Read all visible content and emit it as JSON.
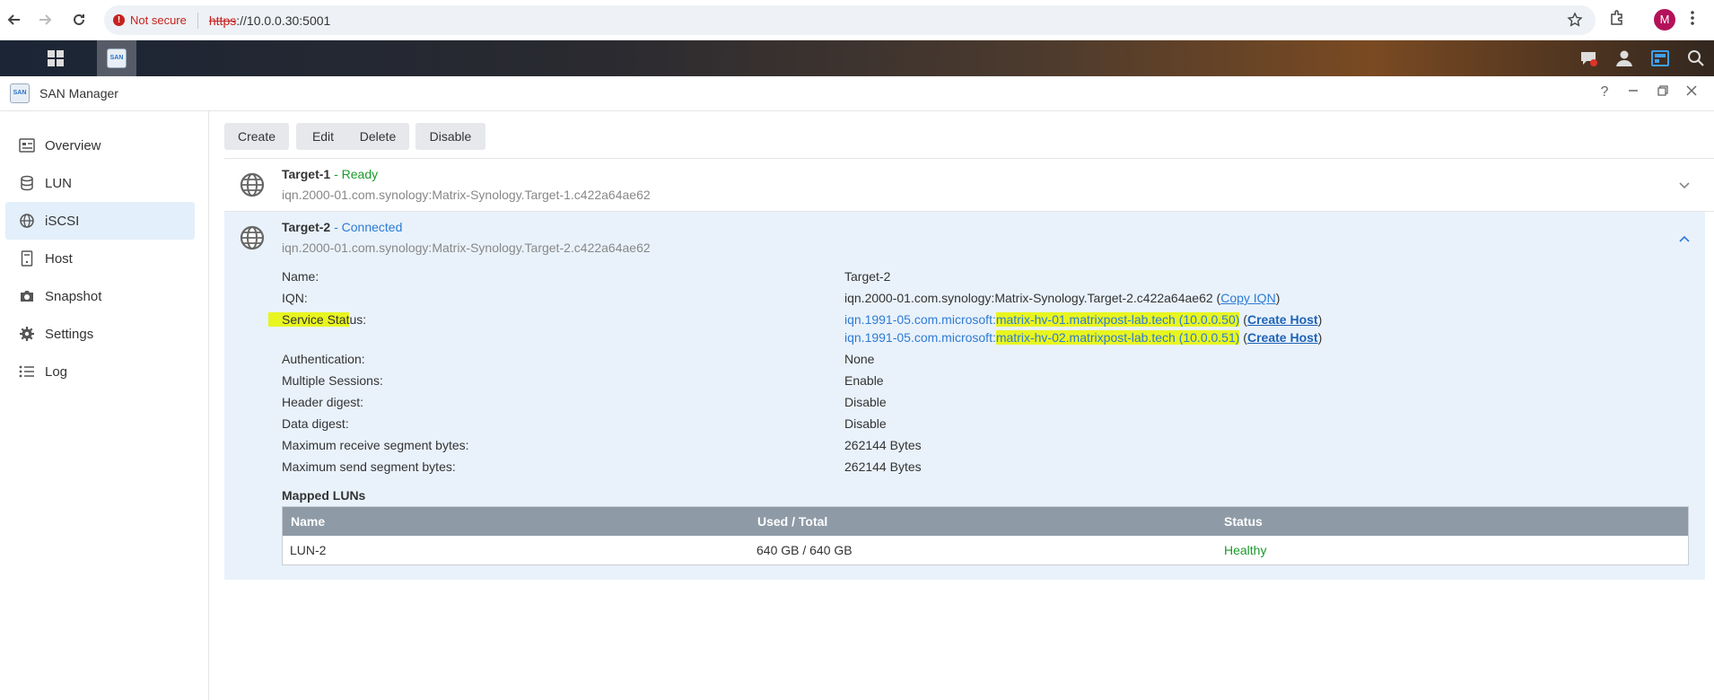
{
  "browser": {
    "security_label": "Not secure",
    "url_scheme": "https",
    "url_rest": "://10.0.0.30:5001",
    "profile_initial": "M"
  },
  "window": {
    "title": "SAN Manager"
  },
  "sidebar": {
    "items": [
      {
        "label": "Overview",
        "icon": "overview-icon"
      },
      {
        "label": "LUN",
        "icon": "database-icon"
      },
      {
        "label": "iSCSI",
        "icon": "globe-icon"
      },
      {
        "label": "Host",
        "icon": "host-icon"
      },
      {
        "label": "Snapshot",
        "icon": "camera-icon"
      },
      {
        "label": "Settings",
        "icon": "gear-icon"
      },
      {
        "label": "Log",
        "icon": "list-icon"
      }
    ],
    "active": "iSCSI"
  },
  "toolbar": {
    "create": "Create",
    "edit": "Edit",
    "delete": "Delete",
    "disable": "Disable"
  },
  "targets": [
    {
      "name": "Target-1",
      "separator": " - ",
      "status": "Ready",
      "iqn": "iqn.2000-01.com.synology:Matrix-Synology.Target-1.c422a64ae62",
      "expanded": false
    },
    {
      "name": "Target-2",
      "separator": " - ",
      "status": "Connected",
      "iqn": "iqn.2000-01.com.synology:Matrix-Synology.Target-2.c422a64ae62",
      "expanded": true
    }
  ],
  "details": {
    "name_label": "Name:",
    "name_value": "Target-2",
    "iqn_label": "IQN:",
    "iqn_value": "iqn.2000-01.com.synology:Matrix-Synology.Target-2.c422a64ae62",
    "copy_iqn": "Copy IQN",
    "service_status_label_hl": "Service Stat",
    "service_status_label_rest": "us:",
    "sessions": [
      {
        "prefix": "iqn.1991-05.com.microsoft:",
        "host": "matrix-hv-01.matrixpost-lab.tech (10.0.0.50)",
        "action": "Create Host"
      },
      {
        "prefix": "iqn.1991-05.com.microsoft:",
        "host": "matrix-hv-02.matrixpost-lab.tech (10.0.0.51)",
        "action": "Create Host"
      }
    ],
    "authentication_label": "Authentication:",
    "authentication_value": "None",
    "multi_sessions_label": "Multiple Sessions:",
    "multi_sessions_value": "Enable",
    "header_digest_label": "Header digest:",
    "header_digest_value": "Disable",
    "data_digest_label": "Data digest:",
    "data_digest_value": "Disable",
    "max_recv_label": "Maximum receive segment bytes:",
    "max_recv_value": "262144 Bytes",
    "max_send_label": "Maximum send segment bytes:",
    "max_send_value": "262144 Bytes",
    "mapped_luns_title": "Mapped LUNs"
  },
  "lun_table": {
    "headers": [
      "Name",
      "Used / Total",
      "Status"
    ],
    "rows": [
      {
        "name": "LUN-2",
        "used_total": "640 GB / 640 GB",
        "status": "Healthy"
      }
    ]
  },
  "colors": {
    "ready": "#1a9a29",
    "connected": "#2d7bd4",
    "highlight": "#e8f51f",
    "active_nav": "#e3effa"
  }
}
